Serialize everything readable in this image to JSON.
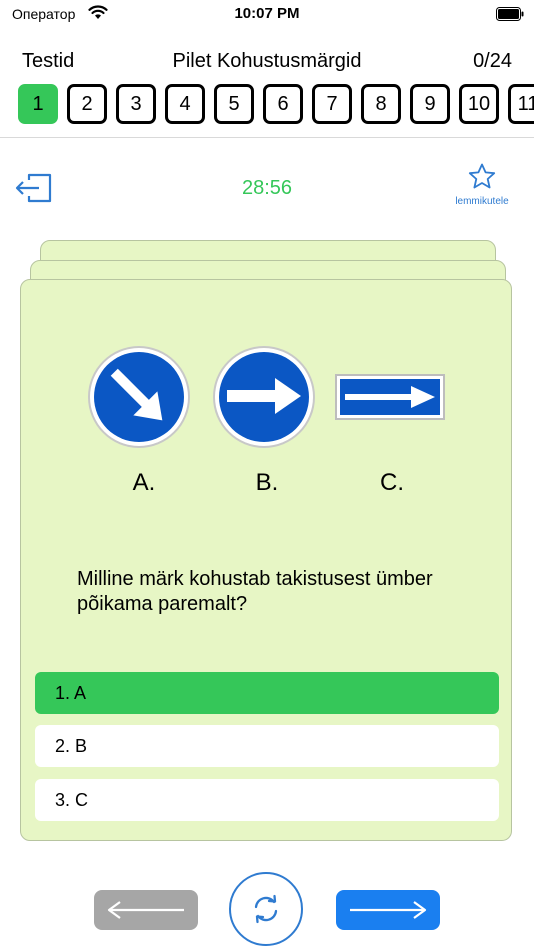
{
  "status": {
    "carrier": "Оператор",
    "time": "10:07 PM"
  },
  "header": {
    "back_label": "Testid",
    "title": "Pilet Kohustusmärgid",
    "progress": "0/24"
  },
  "pager": {
    "active": 1,
    "items": [
      "1",
      "2",
      "3",
      "4",
      "5",
      "6",
      "7",
      "8",
      "9",
      "10",
      "11"
    ]
  },
  "toolbar": {
    "timer": "28:56",
    "favorite_label": "lemmikutele"
  },
  "question": {
    "options_labels": [
      "A.",
      "B.",
      "C."
    ],
    "text": "Milline märk kohustab takistusest ümber põikama paremalt?",
    "answers": [
      {
        "label": "1. A",
        "state": "correct"
      },
      {
        "label": "2. B",
        "state": "neutral"
      },
      {
        "label": "3. C",
        "state": "neutral"
      }
    ]
  },
  "colors": {
    "green": "#35c759",
    "blue": "#1a7ff0",
    "card": "#e7f6c5",
    "sign_blue": "#0b57c4",
    "gray": "#a6a6a6"
  }
}
